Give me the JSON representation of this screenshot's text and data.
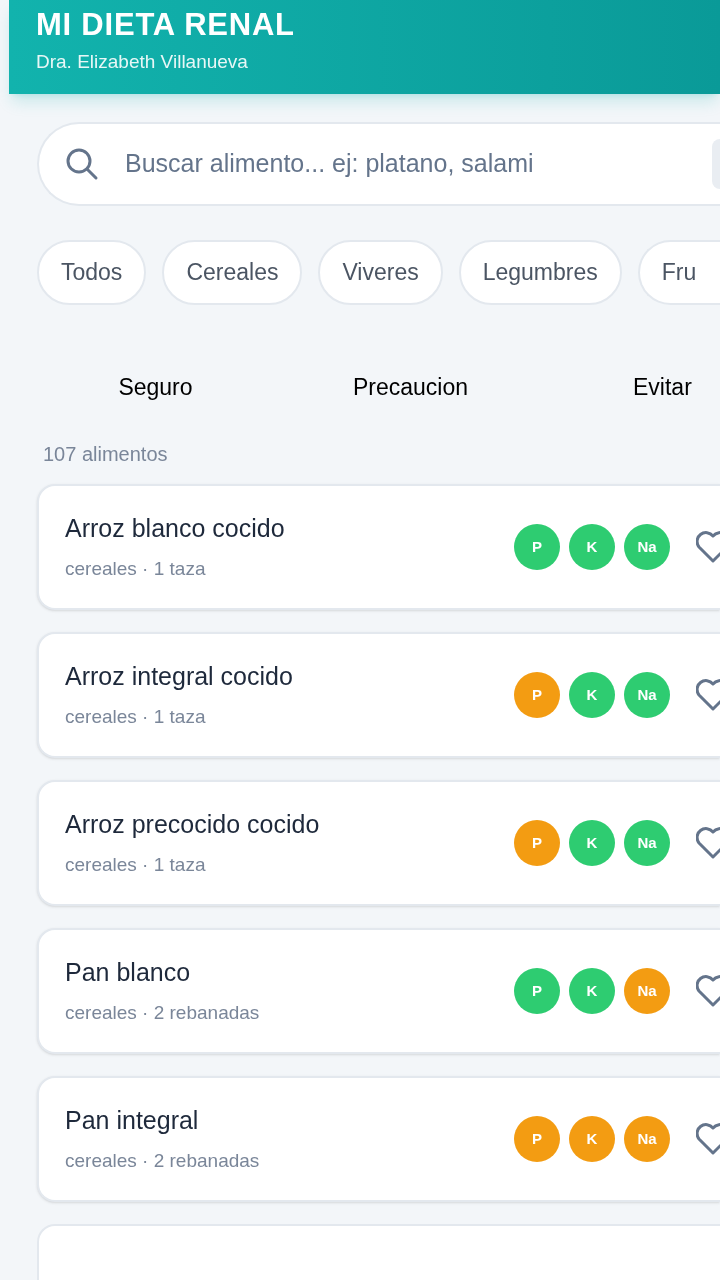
{
  "header": {
    "title": "MI DIETA RENAL",
    "subtitle": "Dra. Elizabeth Villanueva"
  },
  "search": {
    "placeholder": "Buscar alimento... ej: platano, salami"
  },
  "categories": [
    {
      "label": "Todos"
    },
    {
      "label": "Cereales"
    },
    {
      "label": "Viveres"
    },
    {
      "label": "Legumbres"
    },
    {
      "label": "Fru"
    }
  ],
  "legend": [
    "Seguro",
    "Precaucion",
    "Evitar"
  ],
  "count": "107 alimentos",
  "foods": [
    {
      "name": "Arroz blanco cocido",
      "detail": "cereales · 1 taza",
      "nutrients": [
        {
          "label": "P",
          "color": "#2ecc71"
        },
        {
          "label": "K",
          "color": "#2ecc71"
        },
        {
          "label": "Na",
          "color": "#2ecc71"
        }
      ]
    },
    {
      "name": "Arroz integral cocido",
      "detail": "cereales · 1 taza",
      "nutrients": [
        {
          "label": "P",
          "color": "#f39c12"
        },
        {
          "label": "K",
          "color": "#2ecc71"
        },
        {
          "label": "Na",
          "color": "#2ecc71"
        }
      ]
    },
    {
      "name": "Arroz precocido cocido",
      "detail": "cereales · 1 taza",
      "nutrients": [
        {
          "label": "P",
          "color": "#f39c12"
        },
        {
          "label": "K",
          "color": "#2ecc71"
        },
        {
          "label": "Na",
          "color": "#2ecc71"
        }
      ]
    },
    {
      "name": "Pan blanco",
      "detail": "cereales · 2 rebanadas",
      "nutrients": [
        {
          "label": "P",
          "color": "#2ecc71"
        },
        {
          "label": "K",
          "color": "#2ecc71"
        },
        {
          "label": "Na",
          "color": "#f39c12"
        }
      ]
    },
    {
      "name": "Pan integral",
      "detail": "cereales · 2 rebanadas",
      "nutrients": [
        {
          "label": "P",
          "color": "#f39c12"
        },
        {
          "label": "K",
          "color": "#f39c12"
        },
        {
          "label": "Na",
          "color": "#f39c12"
        }
      ]
    }
  ]
}
